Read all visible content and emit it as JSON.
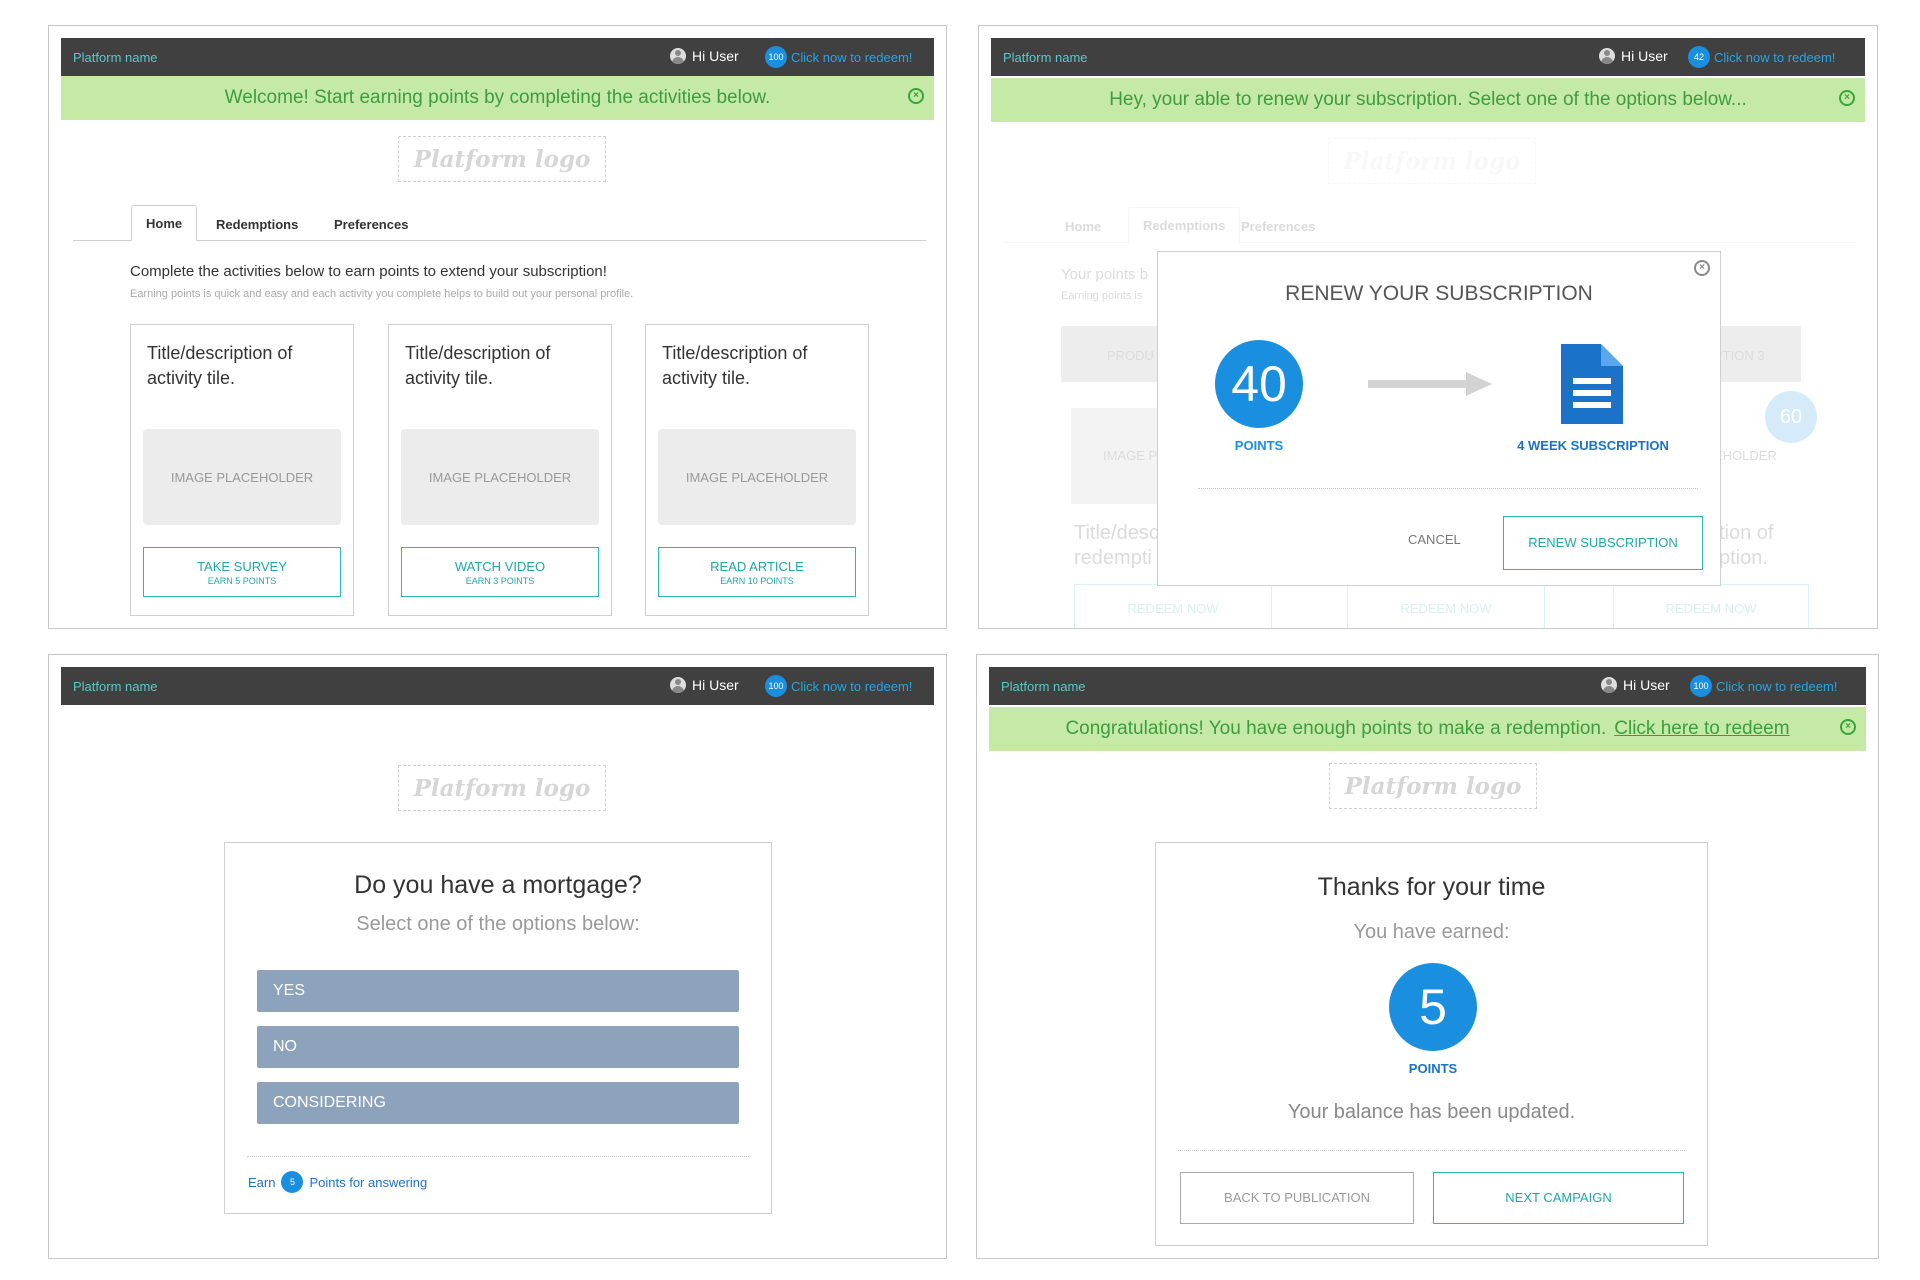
{
  "common": {
    "platform_name": "Platform name",
    "user_greeting": "Hi User",
    "redeem_text": "Click now to redeem!",
    "logo_text": "Platform logo"
  },
  "panel1": {
    "points": "100",
    "banner": "Welcome! Start earning points by completing the activities below.",
    "tabs": [
      "Home",
      "Redemptions",
      "Preferences"
    ],
    "intro": "Complete the activities below to earn points to extend your subscription!",
    "subintro": "Earning points is quick and easy and each activity you complete helps to build out your personal profile.",
    "tiles": [
      {
        "title": "Title/description of activity tile.",
        "image": "IMAGE PLACEHOLDER",
        "action": "TAKE SURVEY",
        "earn": "EARN 5 POINTS"
      },
      {
        "title": "Title/description of activity tile.",
        "image": "IMAGE PLACEHOLDER",
        "action": "WATCH VIDEO",
        "earn": "EARN 3 POINTS"
      },
      {
        "title": "Title/description of activity tile.",
        "image": "IMAGE PLACEHOLDER",
        "action": "READ ARTICLE",
        "earn": "EARN 10 POINTS"
      }
    ]
  },
  "panel2": {
    "points": "42",
    "banner": "Hey, your able to renew your subscription. Select one of the options below...",
    "bg_tabs": [
      "Home",
      "Redemptions",
      "Preferences"
    ],
    "bg_intro": "Your points b",
    "bg_earn": "Earning points is",
    "bg_product": "PRODU",
    "bg_option3": "PTION 3",
    "bg_image": "IMAGE P",
    "bg_holder": "EHOLDER",
    "bg_title_left": [
      "Title/desc",
      "redempti"
    ],
    "bg_title_right": [
      "tion of",
      "ption."
    ],
    "bg_badge": "60",
    "bg_redeem": [
      "REDEEM NOW",
      "REDEEM NOW",
      "REDEEM NOW"
    ],
    "modal": {
      "title": "RENEW YOUR SUBSCRIPTION",
      "points_value": "40",
      "points_label": "POINTS",
      "subscription_label": "4 WEEK SUBSCRIPTION",
      "cancel": "CANCEL",
      "renew": "RENEW SUBSCRIPTION"
    }
  },
  "panel3": {
    "points": "100",
    "question": "Do you have a mortgage?",
    "instruction": "Select one of the options below:",
    "options": [
      "YES",
      "NO",
      "CONSIDERING"
    ],
    "earn_prefix": "Earn",
    "earn_points": "5",
    "earn_suffix": "Points for answering"
  },
  "panel4": {
    "points": "100",
    "banner": "Congratulations! You have enough points to make a redemption.",
    "banner_link": "Click here to redeem",
    "title": "Thanks for your time",
    "earned_label": "You have earned:",
    "earned_value": "5",
    "earned_unit": "POINTS",
    "balance_text": "Your balance has been updated.",
    "back_button": "BACK TO PUBLICATION",
    "next_button": "NEXT CAMPAIGN"
  },
  "colors": {
    "accent_blue": "#1a8fe0",
    "teal": "#20a7a5",
    "banner_green": "#c5eaa6",
    "topbar": "#404040",
    "option_slate": "#8da2bb"
  },
  "icons": [
    "user-icon",
    "close-circle-icon",
    "arrow-right-icon",
    "document-icon"
  ]
}
